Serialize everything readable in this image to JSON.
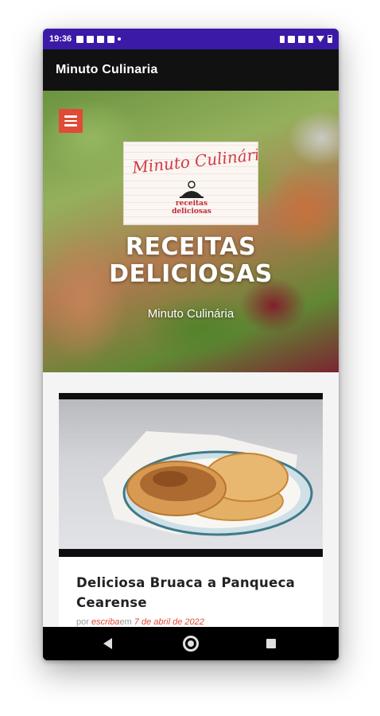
{
  "status_bar": {
    "time": "19:36",
    "left_icons": [
      "facebook-icon",
      "video-icon",
      "twitter-icon",
      "twitter-icon",
      "dot-icon"
    ],
    "right_icons": [
      "bluetooth-icon",
      "nfc-icon",
      "vibrate-icon",
      "data-icon",
      "wifi-icon",
      "battery-icon"
    ]
  },
  "app_bar": {
    "title": "Minuto Culinaria"
  },
  "hero": {
    "menu_icon": "hamburger-menu-icon",
    "logo": {
      "script_text": "Minuto Culinária",
      "tagline_line1": "receitas",
      "tagline_line2": "deliciosas"
    },
    "title_line1": "RECEITAS",
    "title_line2": "DELICIOSAS",
    "subtitle": "Minuto Culinária"
  },
  "post": {
    "title": "Deliciosa Bruaca a Panqueca Cearense",
    "meta_prefix": "por ",
    "author": "escriba",
    "meta_middle": "em ",
    "date": "7 de abril de 2022"
  },
  "nav_bar": {
    "icons": [
      "back-icon",
      "home-icon",
      "recents-icon"
    ]
  },
  "colors": {
    "status_bar": "#3b1aa8",
    "app_bar": "#111111",
    "accent": "#e04a36"
  }
}
